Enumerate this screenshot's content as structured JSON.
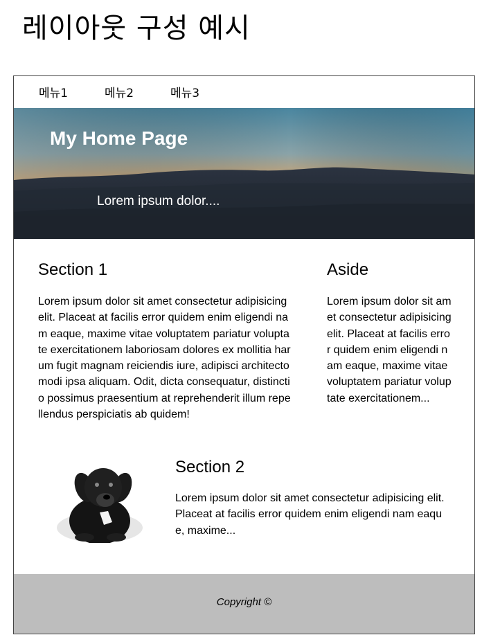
{
  "page_title": "레이아웃 구성 예시",
  "nav": {
    "items": [
      {
        "label": "메뉴1"
      },
      {
        "label": "메뉴2"
      },
      {
        "label": "메뉴3"
      }
    ]
  },
  "hero": {
    "title": "My Home Page",
    "subtitle": "Lorem ipsum dolor...."
  },
  "section1": {
    "heading": "Section 1",
    "body": "Lorem ipsum dolor sit amet consectetur adipisicing elit. Placeat at facilis error quidem enim eligendi nam eaque, maxime vitae voluptatem pariatur voluptate exercitationem laboriosam dolores ex mollitia harum fugit magnam reiciendis iure, adipisci architecto modi ipsa aliquam. Odit, dicta consequatur, distinctio possimus praesentium at reprehenderit illum repellendus perspiciatis ab quidem!"
  },
  "aside": {
    "heading": "Aside",
    "body": "Lorem ipsum dolor sit amet consectetur adipisicing elit. Placeat at facilis error quidem enim eligendi nam eaque, maxime vitae voluptatem pariatur voluptate exercitationem..."
  },
  "section2": {
    "heading": "Section 2",
    "body": "Lorem ipsum dolor sit amet consectetur adipisicing elit. Placeat at facilis error quidem enim eligendi nam eaque, maxime...",
    "image_icon": "puppy-photo"
  },
  "footer": {
    "copyright": "Copyright ©"
  },
  "colors": {
    "footer_bg": "#bdbdbd",
    "hero_sky_top": "#4f8aa3",
    "hero_sky_glow": "#e8a35a",
    "hero_hills": "#1f2630"
  }
}
